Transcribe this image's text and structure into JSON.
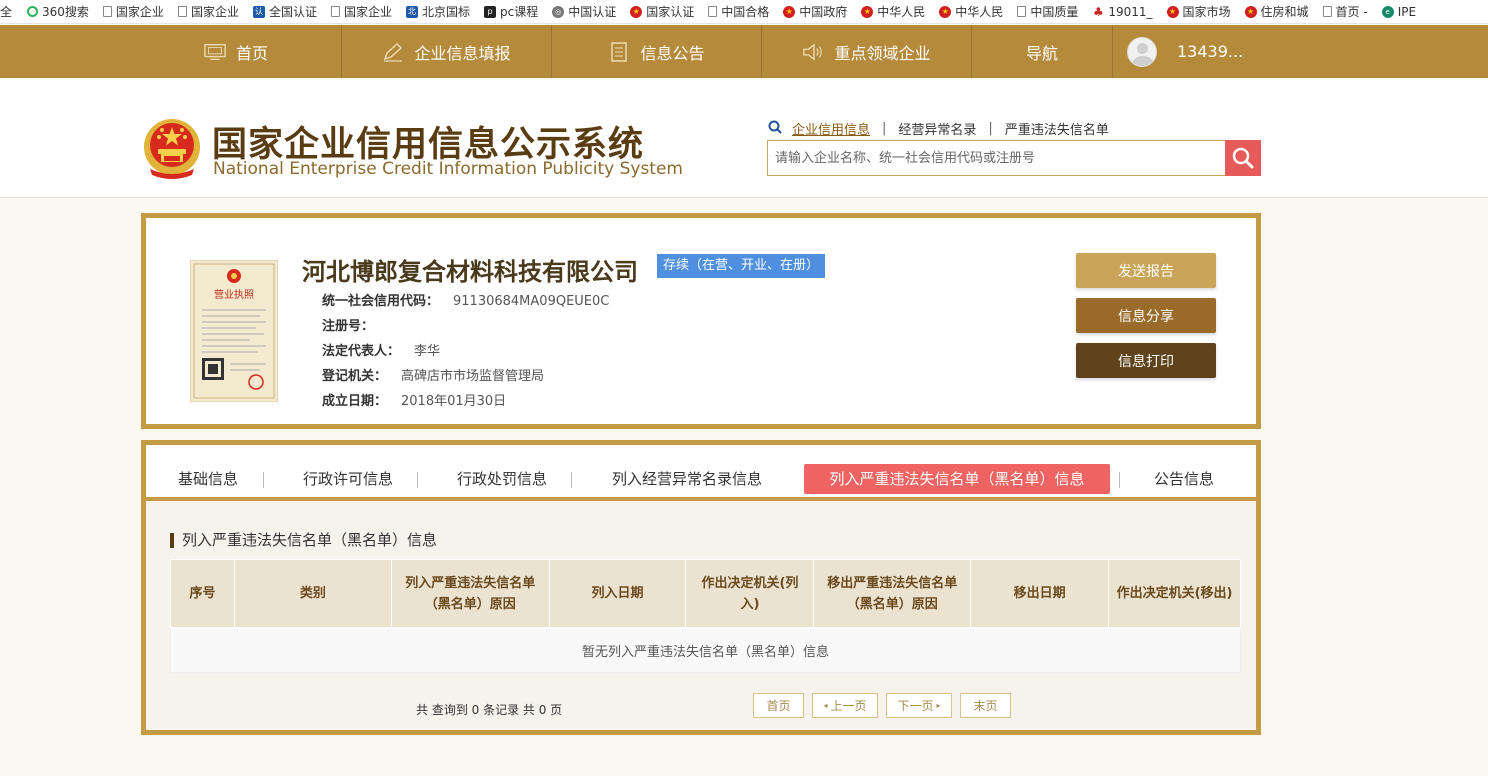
{
  "bookmarks": [
    {
      "label": "全",
      "icon": "none"
    },
    {
      "label": "360搜索",
      "icon": "360-icon"
    },
    {
      "label": "国家企业",
      "icon": "page-icon"
    },
    {
      "label": "国家企业",
      "icon": "page-icon"
    },
    {
      "label": "全国认证",
      "icon": "cnca-icon"
    },
    {
      "label": "国家企业",
      "icon": "page-icon"
    },
    {
      "label": "北京国标",
      "icon": "bsi-icon"
    },
    {
      "label": "pc课程",
      "icon": "course-icon"
    },
    {
      "label": "中国认证",
      "icon": "globe-icon"
    },
    {
      "label": "国家认证",
      "icon": "emblem-icon"
    },
    {
      "label": "中国合格",
      "icon": "page-icon"
    },
    {
      "label": "中国政府",
      "icon": "emblem-icon"
    },
    {
      "label": "中华人民",
      "icon": "emblem-icon"
    },
    {
      "label": "中华人民",
      "icon": "emblem-icon"
    },
    {
      "label": "中国质量",
      "icon": "page-icon"
    },
    {
      "label": "19011_",
      "icon": "person-icon"
    },
    {
      "label": "国家市场",
      "icon": "emblem-icon"
    },
    {
      "label": "住房和城",
      "icon": "emblem-icon"
    },
    {
      "label": "首页 -",
      "icon": "page-icon"
    },
    {
      "label": "IPE",
      "icon": "ipe-icon"
    }
  ],
  "nav": {
    "home": "首页",
    "fill": "企业信息填报",
    "notice": "信息公告",
    "key": "重点领域企业",
    "guide": "导航",
    "user": "13439..."
  },
  "header": {
    "title_cn": "国家企业信用信息公示系统",
    "title_en": "National Enterprise Credit Information Publicity System",
    "links": [
      "企业信用信息",
      "经营异常名录",
      "严重违法失信名单"
    ],
    "search_placeholder": "请输入企业名称、统一社会信用代码或注册号"
  },
  "company": {
    "name": "河北博郎复合材料科技有限公司",
    "status": "存续（在营、开业、在册）",
    "fields": [
      {
        "key": "统一社会信用代码：",
        "value": "91130684MA09QEUE0C"
      },
      {
        "key": "注册号：",
        "value": ""
      },
      {
        "key": "法定代表人：",
        "value": "李华"
      },
      {
        "key": "登记机关：",
        "value": "高碑店市市场监督管理局"
      },
      {
        "key": "成立日期：",
        "value": "2018年01月30日"
      }
    ],
    "license_text": "营业执照",
    "buttons": {
      "send": "发送报告",
      "share": "信息分享",
      "print": "信息打印"
    }
  },
  "tabs": [
    "基础信息",
    "行政许可信息",
    "行政处罚信息",
    "列入经营异常名录信息",
    "列入严重违法失信名单（黑名单）信息",
    "公告信息"
  ],
  "section": {
    "title": "列入严重违法失信名单（黑名单）信息",
    "columns": [
      "序号",
      "类别",
      "列入严重违法失信名单（黑名单）原因",
      "列入日期",
      "作出决定机关(列入)",
      "移出严重违法失信名单（黑名单）原因",
      "移出日期",
      "作出决定机关(移出)"
    ],
    "empty": "暂无列入严重违法失信名单（黑名单）信息",
    "total": "共 查询到 0 条记录 共 0 页"
  },
  "pager": {
    "first": "首页",
    "prev": "上一页",
    "next": "下一页",
    "last": "末页"
  },
  "colors": {
    "gold": "#b58a3a",
    "border_gold": "#c49b45",
    "red": "#ef6363",
    "blue_badge": "#4f8fe0"
  }
}
